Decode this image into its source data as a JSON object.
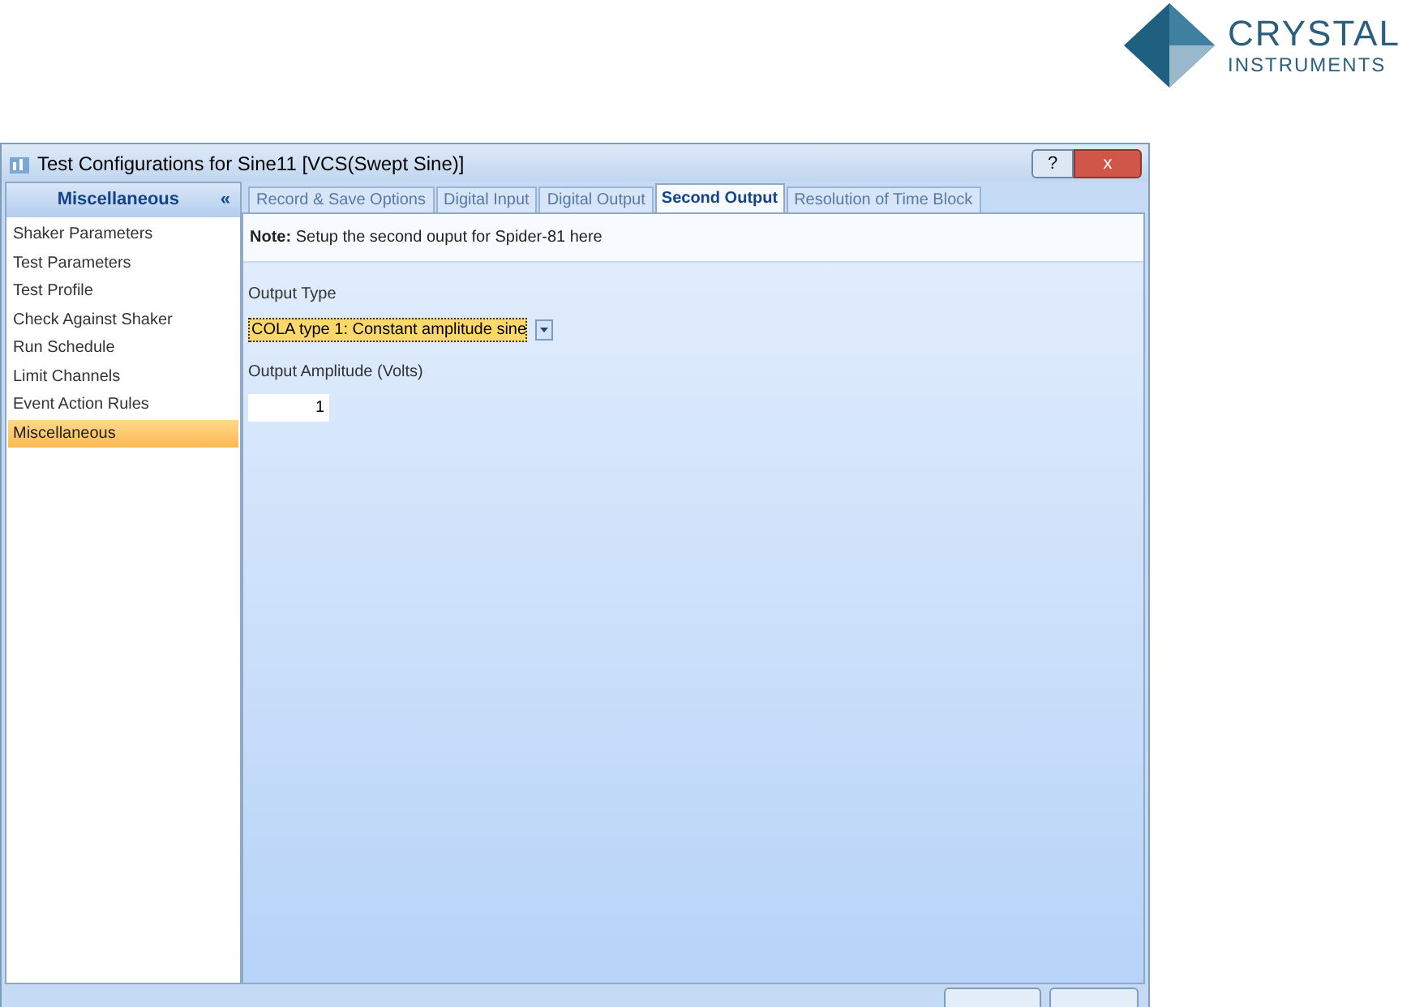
{
  "logo": {
    "line_1": "CRYSTAL",
    "line_2": "INSTRUMENTS"
  },
  "window": {
    "title": "Test Configurations for Sine11 [VCS(Swept Sine)]",
    "help": "?",
    "close": "x"
  },
  "sidebar": {
    "title": "Miscellaneous",
    "collapse": "«",
    "items": [
      {
        "label": "Shaker Parameters",
        "selected": false
      },
      {
        "label": "Test Parameters",
        "selected": false
      },
      {
        "label": "Test Profile",
        "selected": false
      },
      {
        "label": "Check Against Shaker",
        "selected": false
      },
      {
        "label": "Run Schedule",
        "selected": false
      },
      {
        "label": "Limit Channels",
        "selected": false
      },
      {
        "label": "Event Action Rules",
        "selected": false
      },
      {
        "label": "Miscellaneous",
        "selected": true
      }
    ]
  },
  "tabs": [
    {
      "label": "Record & Save Options",
      "selected": false
    },
    {
      "label": "Digital Input",
      "selected": false
    },
    {
      "label": "Digital Output",
      "selected": false
    },
    {
      "label": "Second Output",
      "selected": true
    },
    {
      "label": "Resolution of Time Block",
      "selected": false
    }
  ],
  "note": "**Note:** Setup the second ouput for Spider-81 here",
  "output_type": {
    "label": "Output Type",
    "value": "COLA type 1: Constant amplitude sine"
  },
  "output_amplitude": {
    "label": "Output Amplitude (Volts)",
    "value": "1"
  }
}
